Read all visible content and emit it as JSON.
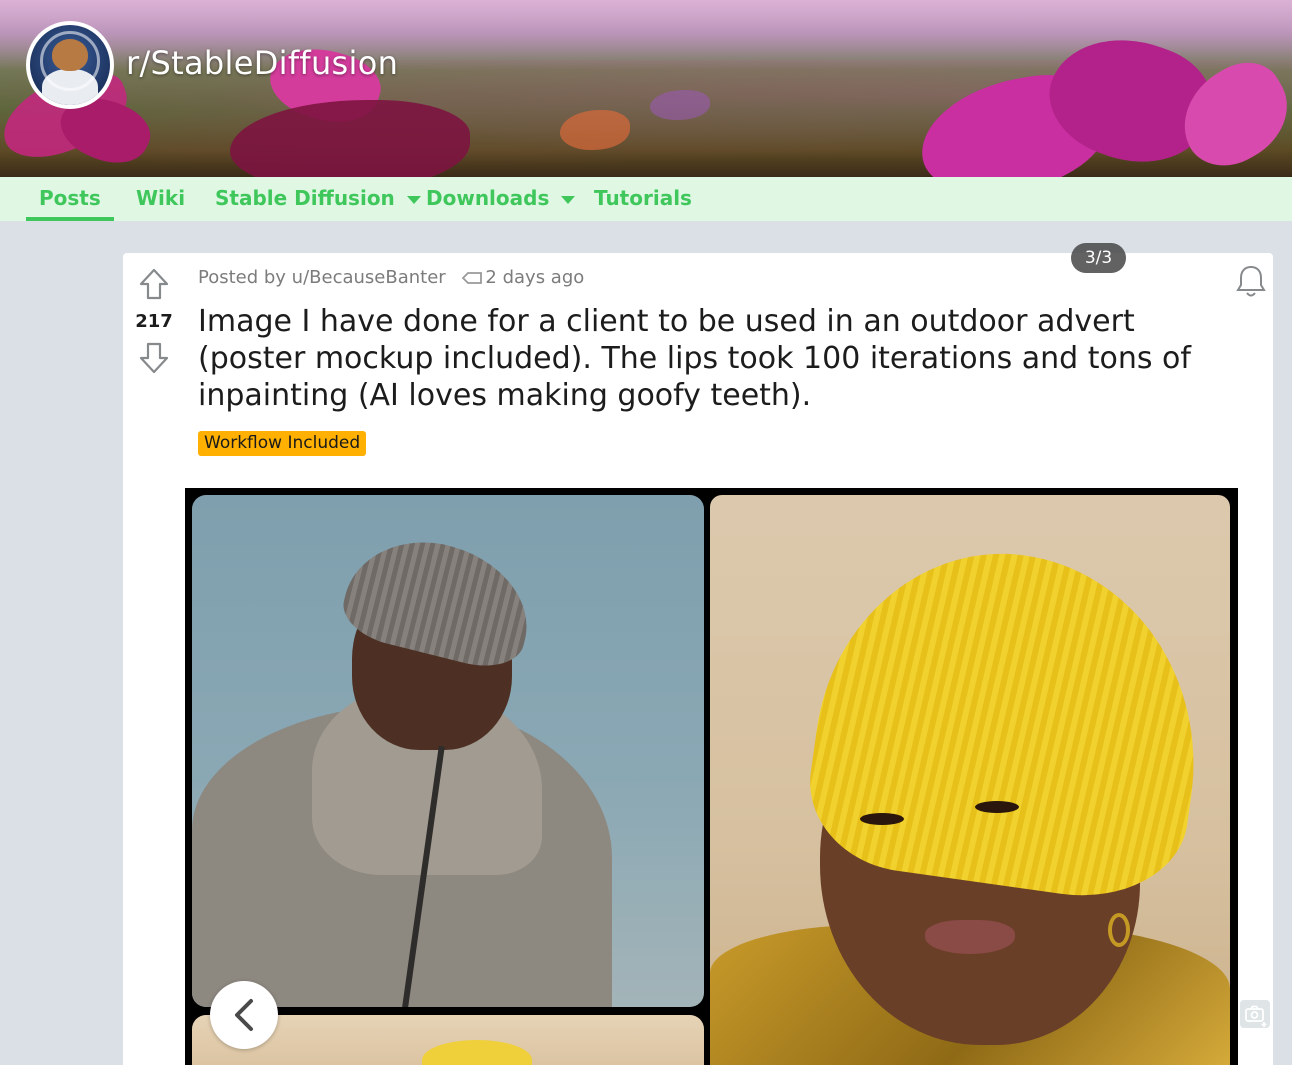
{
  "subreddit": {
    "name": "r/StableDiffusion",
    "avatar_icon": "astronaut-dog-avatar"
  },
  "nav": {
    "items": [
      {
        "label": "Posts",
        "active": true
      },
      {
        "label": "Wiki",
        "active": false
      },
      {
        "label": "Stable Diffusion",
        "active": false,
        "dropdown": true
      },
      {
        "label": "Downloads",
        "active": false,
        "dropdown": true
      },
      {
        "label": "Tutorials",
        "active": false
      }
    ],
    "accent_color": "#3fc75c",
    "background_color": "#dff7e3"
  },
  "post": {
    "score": "217",
    "posted_by": "Posted by u/BecauseBanter",
    "time_ago": "2 days ago",
    "title": "Image I have done for a client to be used in an outdoor advert (poster mockup included). The lips took 100 iterations and tons of inpainting (AI loves making goofy teeth).",
    "flair": "Workflow Included",
    "flair_color": "#ffb000",
    "icons": {
      "upvote": "upvote-arrow-icon",
      "downvote": "downvote-arrow-icon",
      "award": "tag-icon",
      "notify": "bell-icon"
    }
  },
  "gallery": {
    "counter": "3/3",
    "prev_icon": "chevron-left-icon",
    "camera_icon": "camera-icon"
  }
}
